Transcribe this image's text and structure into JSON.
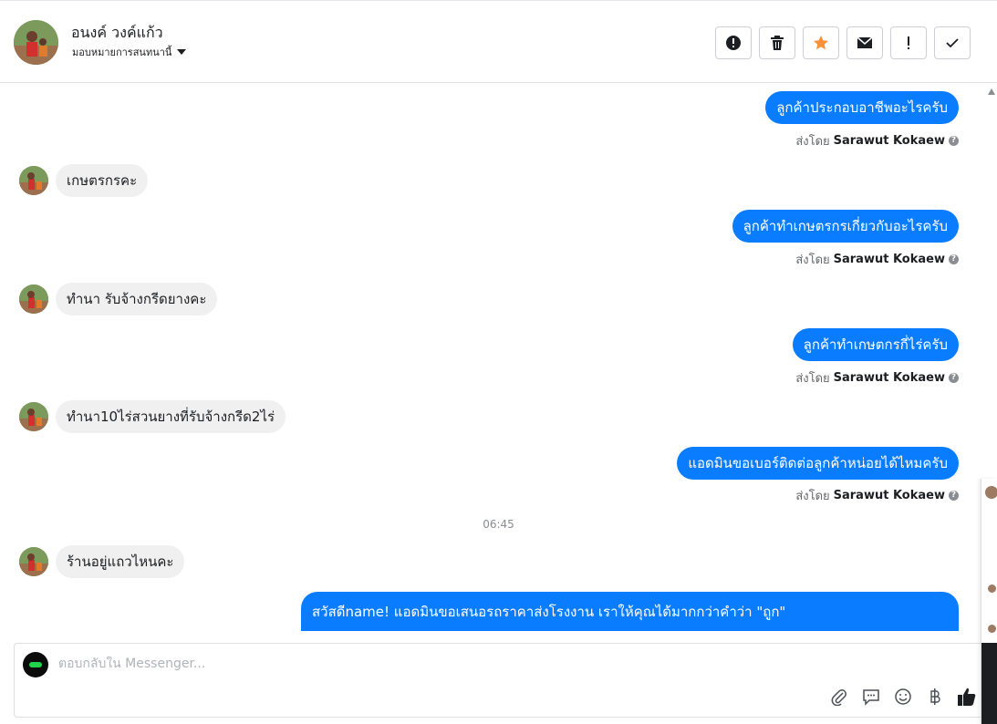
{
  "header": {
    "contact_name": "อนงค์ วงค์แก้ว",
    "assign_label": "มอบหมายการสนทนานี้",
    "actions": [
      {
        "name": "report-spam-button",
        "icon": "alert-circle-icon"
      },
      {
        "name": "delete-button",
        "icon": "trash-icon"
      },
      {
        "name": "star-button",
        "icon": "star-icon"
      },
      {
        "name": "mark-unread-button",
        "icon": "envelope-icon"
      },
      {
        "name": "follow-up-button",
        "icon": "exclamation-icon"
      },
      {
        "name": "mark-done-button",
        "icon": "check-icon"
      }
    ]
  },
  "messages": {
    "m1": {
      "text": "ลูกค้าประกอบอาชีพอะไรครับ",
      "sent_by_prefix": "ส่งโดย",
      "sender": "Sarawut Kokaew"
    },
    "m2": {
      "text": "เกษตรกรคะ"
    },
    "m3": {
      "text": "ลูกค้าทำเกษตรกรเกี่ยวกับอะไรครับ",
      "sent_by_prefix": "ส่งโดย",
      "sender": "Sarawut Kokaew"
    },
    "m4": {
      "text": "ทำนา รับจ้างกรีดยางคะ"
    },
    "m5": {
      "text": "ลูกค้าทำเกษตกรกี่ไร่ครับ",
      "sent_by_prefix": "ส่งโดย",
      "sender": "Sarawut Kokaew"
    },
    "m6": {
      "text": "ทำนา10ไร่สวนยางที่รับจ้างกรีด2ไร่"
    },
    "m7": {
      "text": "แอดมินขอเบอร์ติดต่อลูกค้าหน่อยได้ไหมครับ",
      "sent_by_prefix": "ส่งโดย",
      "sender": "Sarawut Kokaew"
    },
    "timestamp": "06:45",
    "m8": {
      "text": "ร้านอยู่แถวไหนคะ"
    },
    "m9": {
      "text": "สวัสดีname! แอดมินขอเสนอรถราคาส่งโรงงาน เราให้คุณได้มากกว่าคำว่า \"ถูก\""
    }
  },
  "composer": {
    "placeholder": "ตอบกลับใน Messenger...",
    "tools": [
      "paperclip-icon",
      "saved-replies-icon",
      "emoji-icon",
      "baht-icon",
      "thumbs-up-icon"
    ]
  },
  "colors": {
    "outgoing": "#0a7cff",
    "incoming": "#f0f0f0",
    "star": "#f7923a"
  }
}
